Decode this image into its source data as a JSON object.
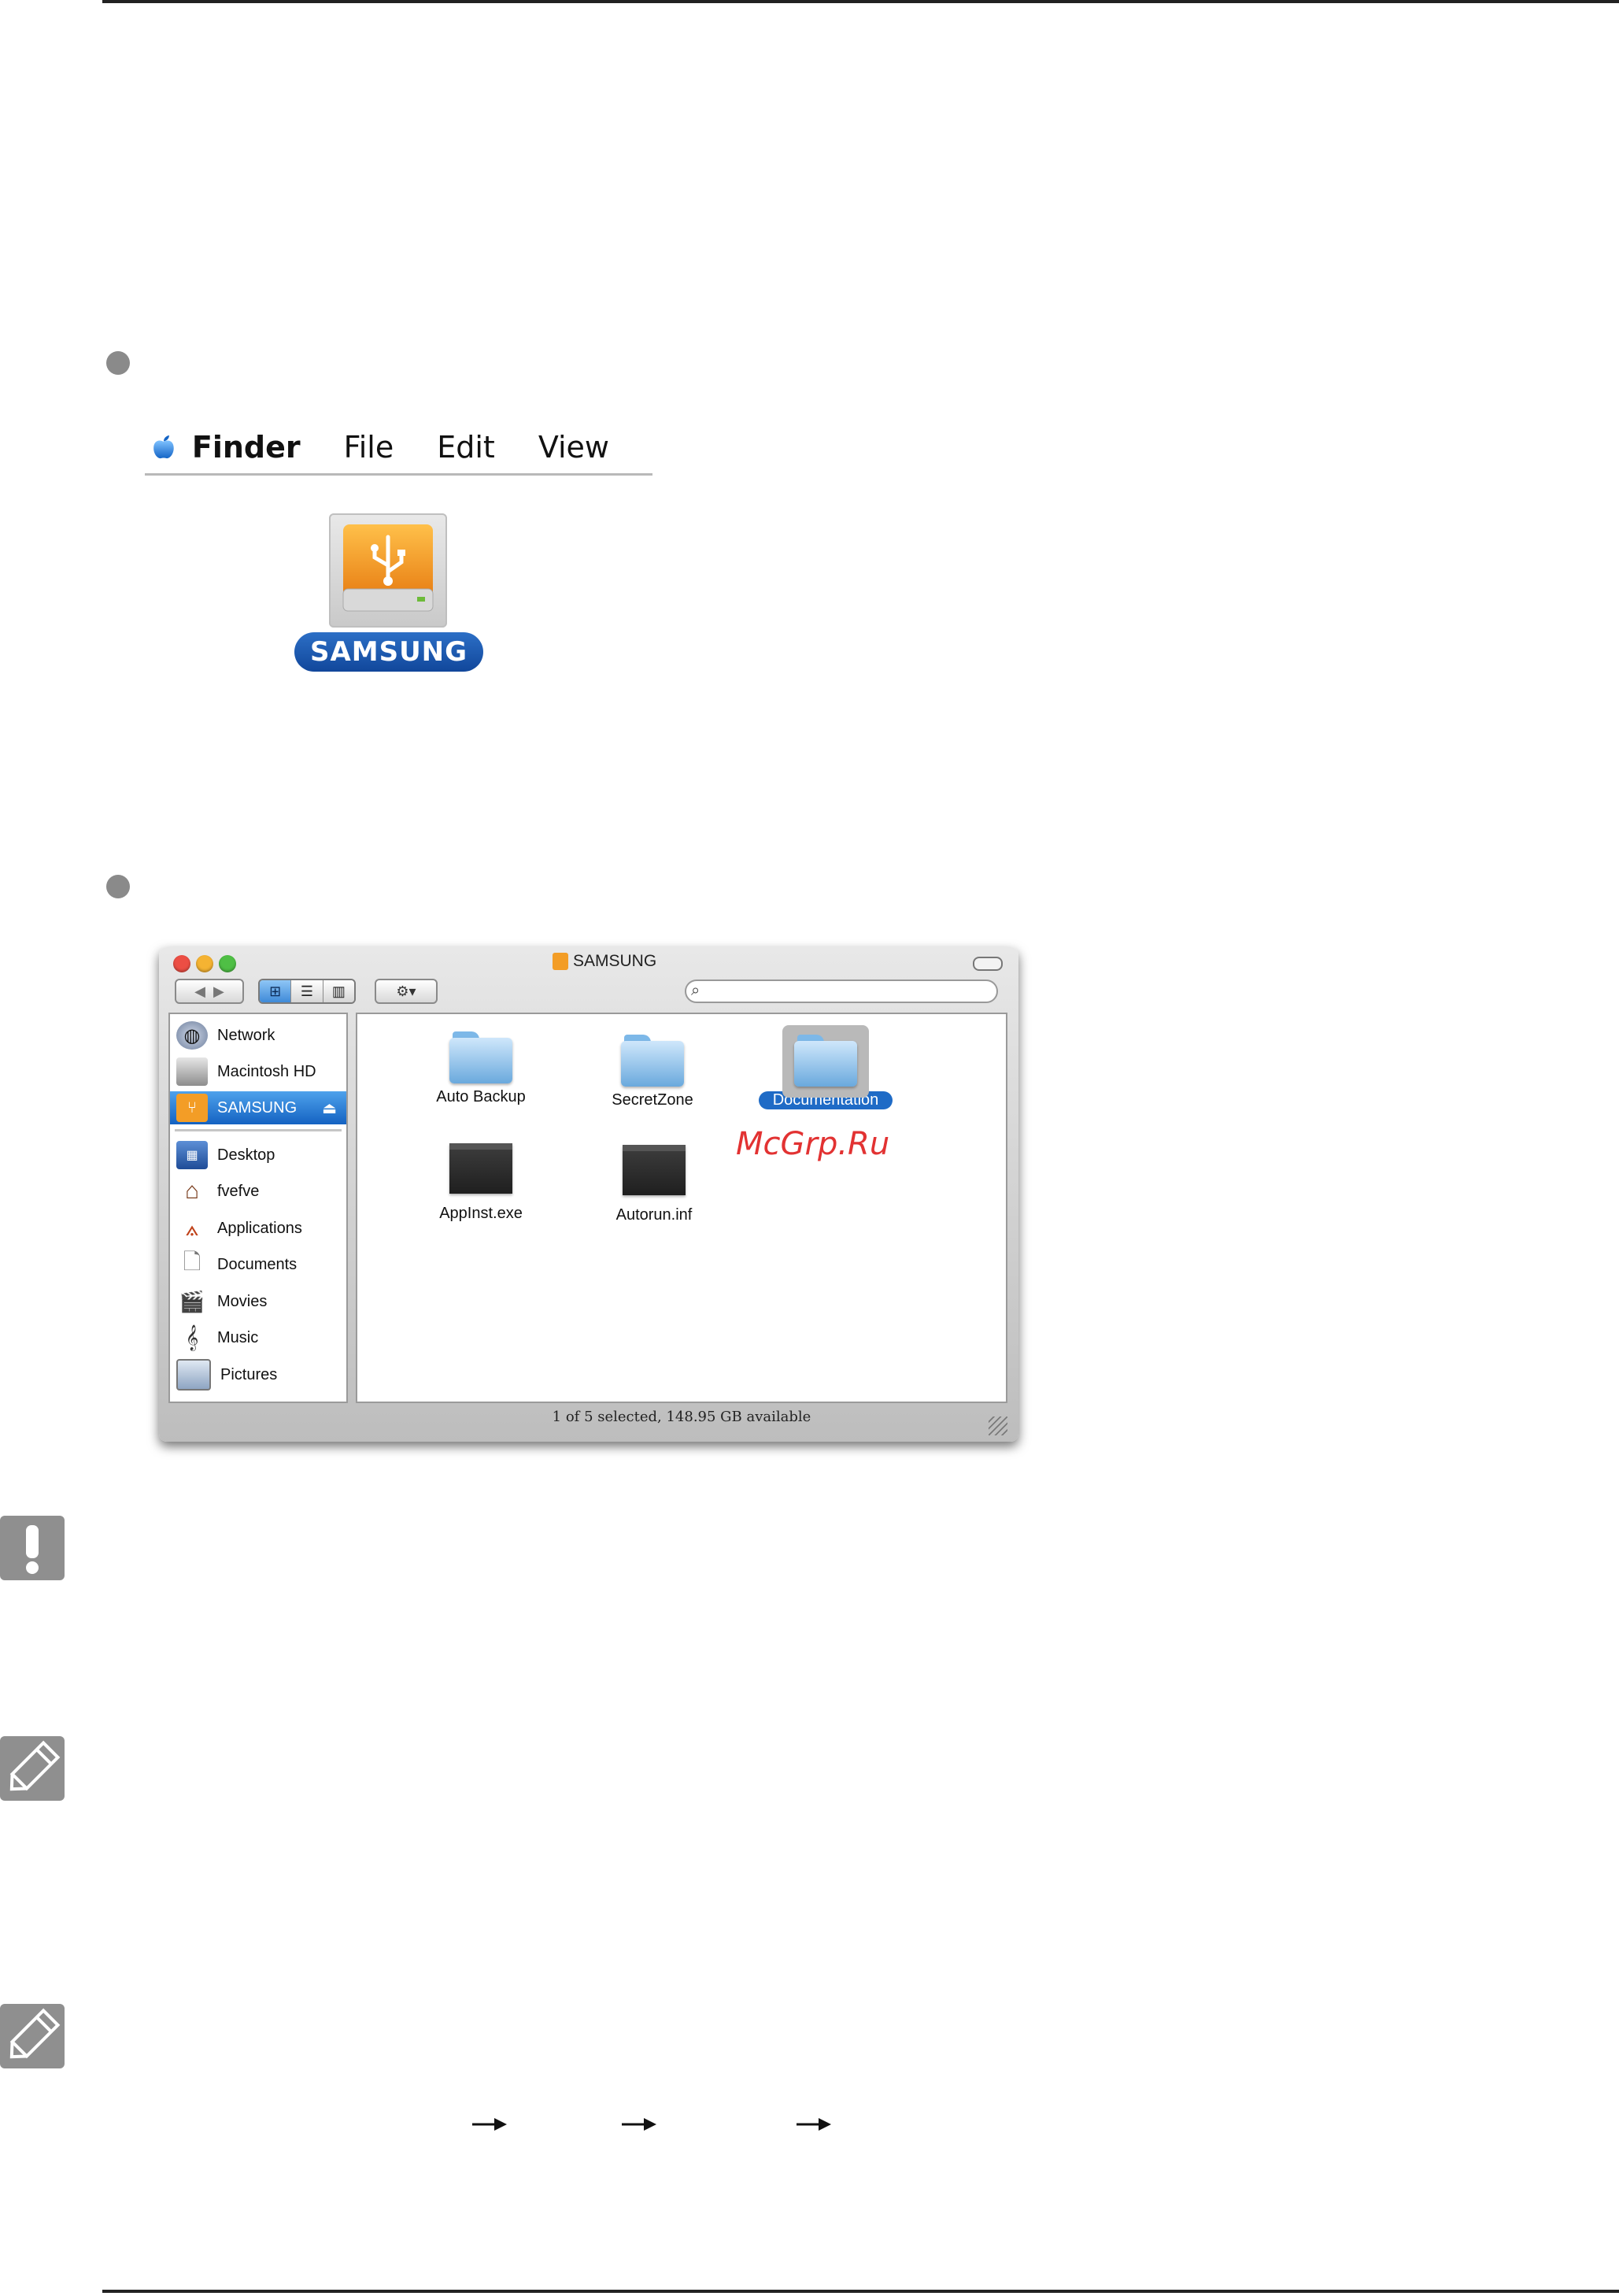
{
  "menubar": {
    "items": [
      "Finder",
      "File",
      "Edit",
      "View"
    ]
  },
  "drive_icon": {
    "label": "SAMSUNG",
    "accent_color": "#f39d26"
  },
  "finder": {
    "title": "SAMSUNG",
    "view_buttons": [
      "icon-view-icon",
      "list-view-icon",
      "column-view-icon"
    ],
    "sidebar": {
      "devices": [
        {
          "label": "Network",
          "icon": "network-icon"
        },
        {
          "label": "Macintosh HD",
          "icon": "hard-drive-icon"
        },
        {
          "label": "SAMSUNG",
          "icon": "usb-drive-icon",
          "selected": true
        }
      ],
      "places": [
        {
          "label": "Desktop",
          "icon": "desktop-icon"
        },
        {
          "label": "fvefve",
          "icon": "home-icon"
        },
        {
          "label": "Applications",
          "icon": "applications-icon"
        },
        {
          "label": "Documents",
          "icon": "documents-icon"
        },
        {
          "label": "Movies",
          "icon": "movies-icon"
        },
        {
          "label": "Music",
          "icon": "music-icon"
        },
        {
          "label": "Pictures",
          "icon": "pictures-icon"
        }
      ]
    },
    "files": [
      {
        "label": "Auto Backup",
        "type": "folder"
      },
      {
        "label": "SecretZone",
        "type": "folder"
      },
      {
        "label": "Documentation",
        "type": "folder",
        "selected": true
      },
      {
        "label": "AppInst.exe",
        "type": "executable"
      },
      {
        "label": "Autorun.inf",
        "type": "executable"
      }
    ],
    "status": "1 of 5 selected, 148.95 GB available"
  },
  "watermark": "McGrp.Ru",
  "colors": {
    "selection": "#1f6bc6",
    "drive_orange": "#f39d26",
    "badge_gray": "#8f8f8f"
  }
}
